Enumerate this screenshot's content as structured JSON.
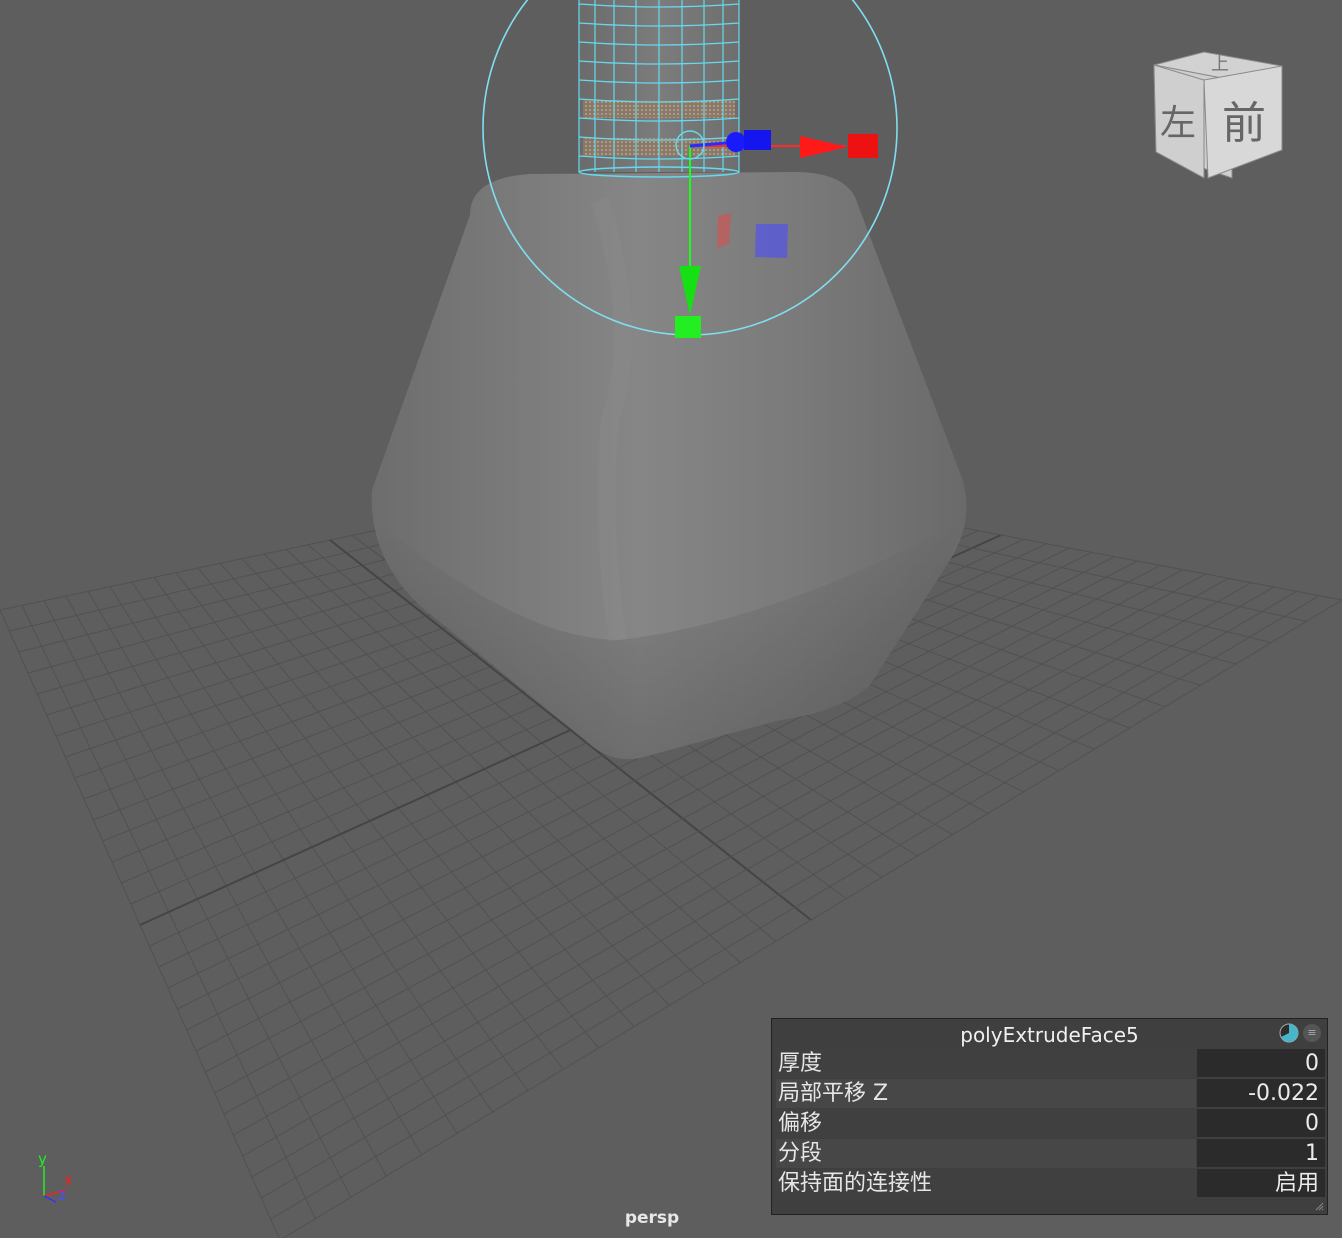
{
  "viewport": {
    "camera_label": "persp"
  },
  "view_cube": {
    "top_face": "上",
    "front_face": "前",
    "left_face": "左"
  },
  "axis_indicator": {
    "y": "y",
    "x": "x",
    "z": "z"
  },
  "inview_panel": {
    "title": "polyExtrudeFace5",
    "rows": [
      {
        "label": "厚度",
        "value": "0"
      },
      {
        "label": "局部平移 Z",
        "value": "-0.022"
      },
      {
        "label": "偏移",
        "value": "0"
      },
      {
        "label": "分段",
        "value": "1"
      },
      {
        "label": "保持面的连接性",
        "value": "启用"
      }
    ]
  },
  "colors": {
    "viewport_bg": "#5e5e5e",
    "grid_line": "#4f4f4f",
    "selection_wire": "#66d9ee",
    "manip_x": "#ff1a1a",
    "manip_y": "#1aff1a",
    "manip_z": "#1a1aff"
  }
}
